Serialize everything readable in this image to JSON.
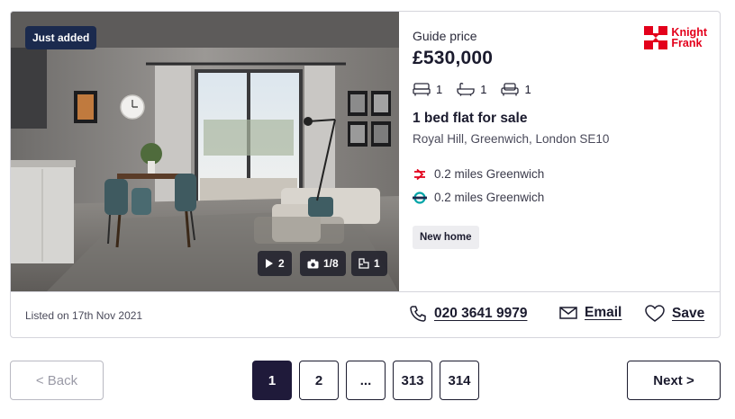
{
  "listing": {
    "badge": "Just added",
    "media": {
      "videos": "2",
      "photos": "1/8",
      "floorplans": "1"
    },
    "guide_label": "Guide price",
    "price": "£530,000",
    "agent_logo": {
      "line1": "Knight",
      "line2": "Frank",
      "color": "#e3001b"
    },
    "features": {
      "bedrooms": "1",
      "bathrooms": "1",
      "receptions": "1"
    },
    "title": "1 bed flat for sale",
    "address": "Royal Hill, Greenwich, London SE10",
    "stations": [
      {
        "type": "national-rail",
        "text": "0.2 miles Greenwich"
      },
      {
        "type": "london-underground",
        "text": "0.2 miles Greenwich"
      }
    ],
    "tag": "New home",
    "listed": "Listed on 17th Nov 2021",
    "phone": "020 3641 9979",
    "email_label": "Email",
    "save_label": "Save"
  },
  "pagination": {
    "back": "< Back",
    "pages": [
      "1",
      "2",
      "...",
      "313",
      "314"
    ],
    "current": "1",
    "next": "Next >"
  },
  "colors": {
    "badge_bg": "#1b2a4e",
    "active_page": "#1f1a3a",
    "rail_red": "#e3001b",
    "tube_teal": "#00a4a7"
  }
}
